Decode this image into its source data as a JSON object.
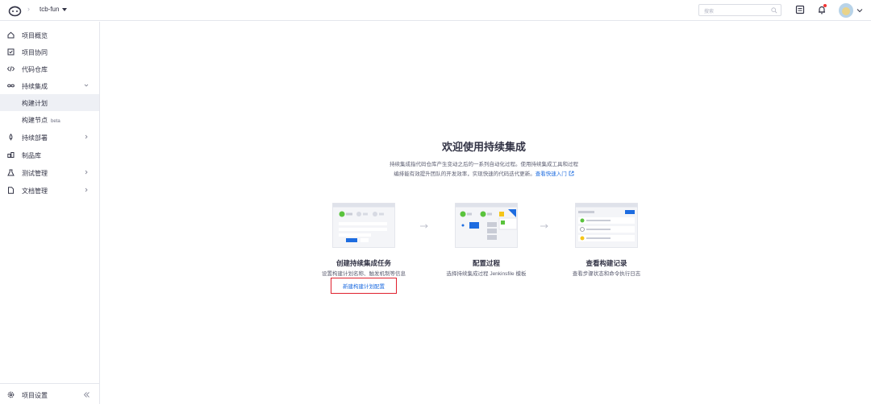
{
  "header": {
    "project_name": "tcb-fun",
    "search_placeholder": "搜索"
  },
  "sidebar": {
    "items": [
      {
        "label": "项目概览"
      },
      {
        "label": "项目协同"
      },
      {
        "label": "代码仓库"
      },
      {
        "label": "持续集成"
      },
      {
        "label": "构建计划"
      },
      {
        "label": "构建节点",
        "badge": "beta"
      },
      {
        "label": "持续部署"
      },
      {
        "label": "制品库"
      },
      {
        "label": "测试管理"
      },
      {
        "label": "文档管理"
      }
    ],
    "footer_label": "项目设置"
  },
  "main": {
    "title": "欢迎使用持续集成",
    "desc_line1": "持续集成指代码仓库产生变动之后的一系列自动化过程。使用持续集成工具和过程",
    "desc_line2": "编排能有效提升团队的开发效率，实现快速的代码迭代更新。",
    "quick_start": "查看快速入门",
    "steps": [
      {
        "title": "创建持续集成任务",
        "desc": "设置构建计划名称、触发机制等信息",
        "link": "新建构建计划配置"
      },
      {
        "title": "配置过程",
        "desc": "选择持续集成过程 Jenkinsfile 模板"
      },
      {
        "title": "查看构建记录",
        "desc": "查看步骤状态和命令执行日志"
      }
    ]
  },
  "colors": {
    "accent": "#1d6ce0",
    "green": "#5ac33d",
    "highlight": "#e0202d"
  }
}
